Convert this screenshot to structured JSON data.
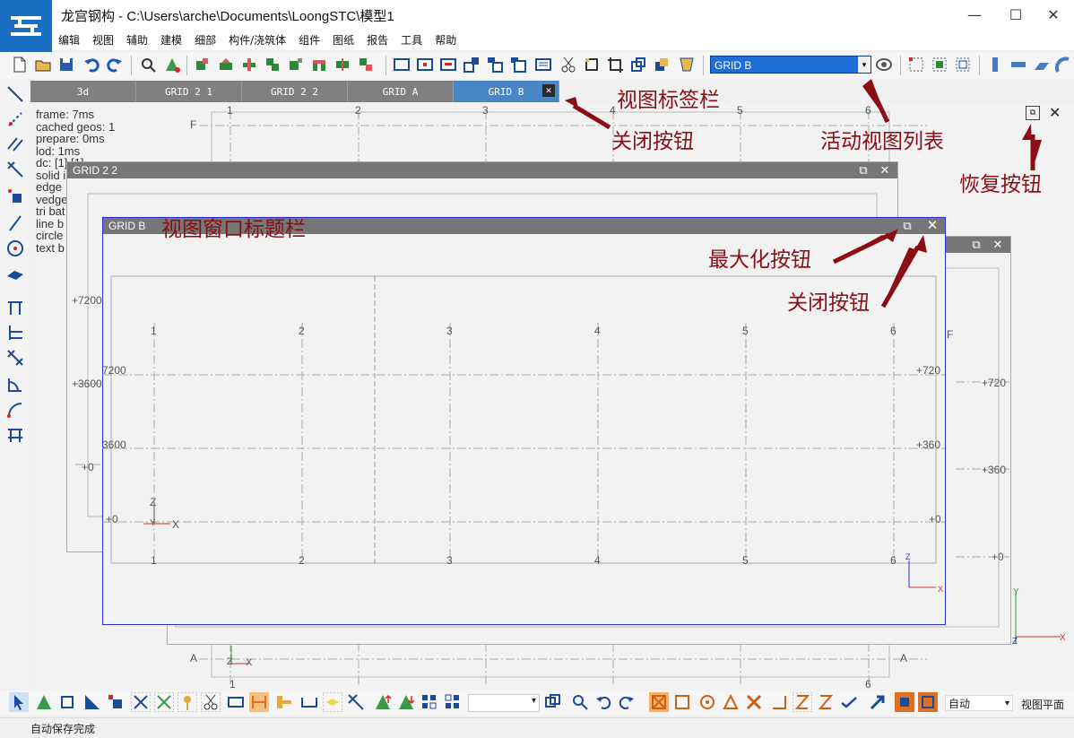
{
  "app": {
    "title": "龙宫钢构 - C:\\Users\\arche\\Documents\\LoongSTC\\模型1",
    "minimize": "—",
    "maximize": "☐",
    "close": "✕"
  },
  "menu": [
    "编辑",
    "视图",
    "辅助",
    "建模",
    "细部",
    "构件/浇筑体",
    "组件",
    "图纸",
    "报告",
    "工具",
    "帮助"
  ],
  "active_view": "GRID B",
  "tabs": [
    {
      "label": "3d",
      "active": false
    },
    {
      "label": "GRID 2 1",
      "active": false
    },
    {
      "label": "GRID 2 2",
      "active": false
    },
    {
      "label": "GRID A",
      "active": false
    },
    {
      "label": "GRID B",
      "active": true
    }
  ],
  "tab_close": "✕",
  "debug": [
    "frame: 7ms",
    "cached geos: 1",
    "prepare: 0ms",
    "lod: 1ms",
    "dc: [1] [1]",
    "solid i",
    "edge",
    "vedge",
    "tri bat",
    "line b",
    "circle",
    "text b"
  ],
  "windows": {
    "grid22": {
      "title": "GRID 2 2"
    },
    "gridb": {
      "title": "GRID B"
    },
    "restore": "⧉",
    "close": "✕"
  },
  "axes": {
    "numbers": [
      "1",
      "2",
      "3",
      "4",
      "5",
      "6"
    ],
    "letters": {
      "top": "F",
      "bottom": "A"
    },
    "levels": [
      "+7200",
      "+3600",
      "+0"
    ],
    "level_labels_short": [
      "7200",
      "3600",
      "+0"
    ],
    "level_labels_right": [
      "+720",
      "+360",
      "+0"
    ],
    "z": "Z",
    "y": "Y",
    "x": "X"
  },
  "annotations": {
    "tab_bar": "视图标签栏",
    "tab_close": "关闭按钮",
    "view_list": "活动视图列表",
    "restore": "恢复按钮",
    "window_title": "视图窗口标题栏",
    "maximize": "最大化按钮",
    "window_close": "关闭按钮"
  },
  "bottom": {
    "mode": "自动",
    "plane": "视图平面"
  },
  "status": "自动保存完成",
  "colors": {
    "accent": "#1e6ed7",
    "annotation": "#8b0e14",
    "tab": "#808080",
    "tab_active": "#4a86c6",
    "frame": "#2b2bd6"
  }
}
